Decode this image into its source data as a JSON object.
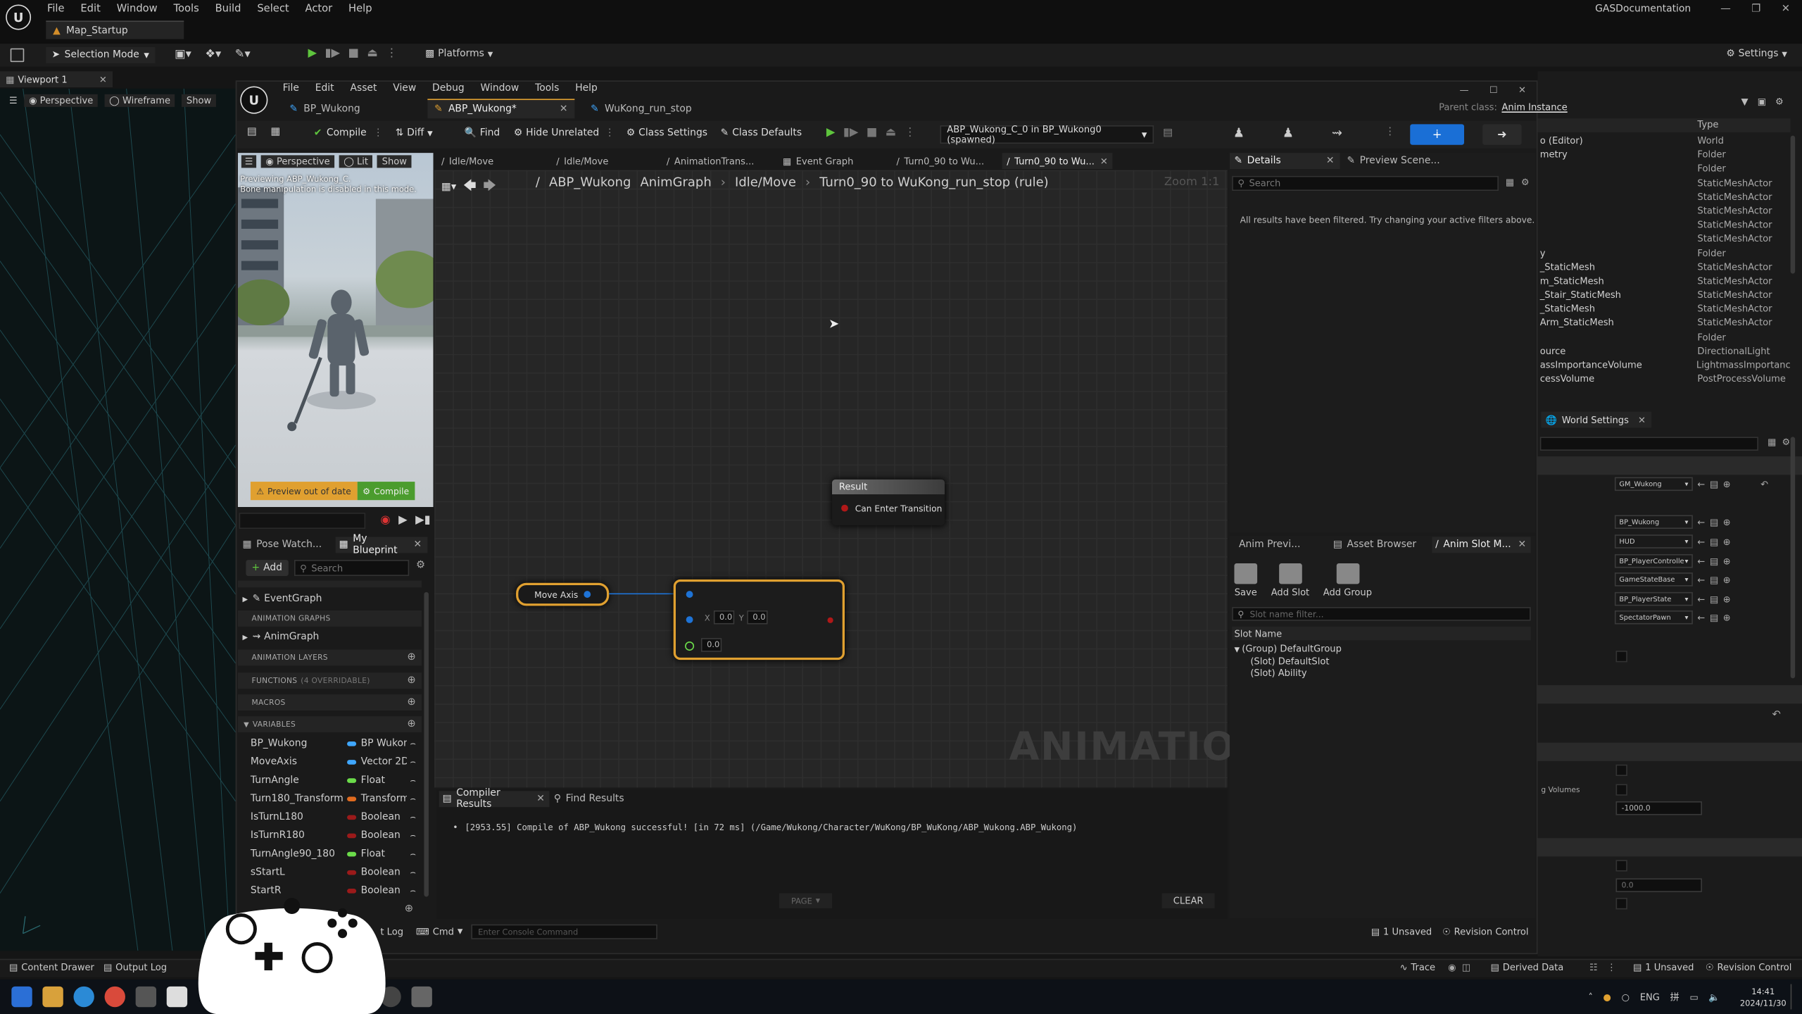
{
  "outer": {
    "menu": [
      "File",
      "Edit",
      "Window",
      "Tools",
      "Build",
      "Select",
      "Actor",
      "Help"
    ],
    "map_tab": "Map_Startup",
    "project": "GASDocumentation",
    "selection_mode": "Selection Mode",
    "platforms": "Platforms",
    "settings": "Settings",
    "viewport_tab": "Viewport 1",
    "perspective": "Perspective",
    "wireframe": "Wireframe",
    "show": "Show",
    "outliner_type_header": "Type",
    "outliner_rows": [
      {
        "name": "o (Editor)",
        "type": "World"
      },
      {
        "name": "metry",
        "type": "Folder"
      },
      {
        "name": "",
        "type": "Folder"
      },
      {
        "name": "",
        "type": "StaticMeshActor"
      },
      {
        "name": "",
        "type": "StaticMeshActor"
      },
      {
        "name": "",
        "type": "StaticMeshActor"
      },
      {
        "name": "",
        "type": "StaticMeshActor"
      },
      {
        "name": "",
        "type": "StaticMeshActor"
      },
      {
        "name": "y",
        "type": "Folder"
      },
      {
        "name": "_StaticMesh",
        "type": "StaticMeshActor"
      },
      {
        "name": "m_StaticMesh",
        "type": "StaticMeshActor"
      },
      {
        "name": "_Stair_StaticMesh",
        "type": "StaticMeshActor"
      },
      {
        "name": "_StaticMesh",
        "type": "StaticMeshActor"
      },
      {
        "name": "Arm_StaticMesh",
        "type": "StaticMeshActor"
      },
      {
        "name": "",
        "type": "Folder"
      },
      {
        "name": "ource",
        "type": "DirectionalLight"
      },
      {
        "name": "assImportanceVolume",
        "type": "LightmassImportanc"
      },
      {
        "name": "cessVolume",
        "type": "PostProcessVolume"
      }
    ],
    "world_settings_tab": "World Settings",
    "ws_dropdowns": [
      "GM_Wukong",
      "BP_Wukong",
      "HUD",
      "BP_PlayerControlle",
      "GameStateBase",
      "BP_PlayerState",
      "SpectatorPawn"
    ],
    "ws_volumes_label": "g Volumes",
    "ws_value_1": "-1000.0",
    "ws_value_2": "0.0",
    "content_drawer": "Content Drawer",
    "output_log": "Output Log",
    "trace": "Trace",
    "derived_data": "Derived Data",
    "unsaved": "1 Unsaved",
    "revision_control": "Revision Control",
    "tray_lang": "ENG",
    "clock_time": "14:41",
    "clock_date": "2024/11/30"
  },
  "inner": {
    "menu": [
      "File",
      "Edit",
      "Asset",
      "View",
      "Debug",
      "Window",
      "Tools",
      "Help"
    ],
    "tabs": [
      "BP_Wukong",
      "ABP_Wukong*",
      "WuKong_run_stop"
    ],
    "parent_class_label": "Parent class:",
    "parent_class_value": "Anim Instance",
    "toolbar": {
      "compile": "Compile",
      "diff": "Diff",
      "find": "Find",
      "hide_unrelated": "Hide Unrelated",
      "class_settings": "Class Settings",
      "class_defaults": "Class Defaults",
      "debug_target": "ABP_Wukong_C_0 in BP_Wukong0 (spawned)"
    },
    "preview": {
      "perspective": "Perspective",
      "lit": "Lit",
      "show": "Show",
      "msg1": "Previewing ABP_Wukong_C.",
      "msg2": "Bone manipulation is disabled in this mode.",
      "out_of_date": "Preview out of date",
      "compile": "Compile"
    },
    "graph_tabs": [
      "Idle/Move",
      "Idle/Move",
      "AnimationTrans...",
      "Event Graph",
      "Turn0_90 to Wu...",
      "Turn0_90 to Wu..."
    ],
    "breadcrumb": [
      "ABP_Wukong",
      "AnimGraph",
      "Idle/Move",
      "Turn0_90 to WuKong_run_stop (rule)"
    ],
    "zoom": "Zoom 1:1",
    "result_node": {
      "title": "Result",
      "pin": "Can Enter Transition"
    },
    "move_axis": "Move Axis",
    "vector_node": {
      "x_label": "X",
      "x_val": "0.0",
      "y_label": "Y",
      "y_val": "0.0",
      "z_val": "0.0"
    },
    "watermark": "ANIMATION",
    "compiler_tab": "Compiler Results",
    "find_results_tab": "Find Results",
    "compile_msg": "[2953.55] Compile of ABP_Wukong successful! [in 72 ms] (/Game/Wukong/Character/WuKong/BP_WuKong/ABP_Wukong.ABP_Wukong)",
    "page": "PAGE",
    "clear": "CLEAR",
    "details_tab": "Details",
    "preview_scene_tab": "Preview Scene...",
    "search_placeholder": "Search",
    "filtered_msg": "All results have been filtered. Try changing your active filters above.",
    "anim_preview_tab": "Anim Previ...",
    "asset_browser_tab": "Asset Browser",
    "anim_slot_tab": "Anim Slot M...",
    "slot_buttons": [
      "Save",
      "Add Slot",
      "Add Group"
    ],
    "slot_filter_placeholder": "Slot name filter...",
    "slot_name_header": "Slot Name",
    "slot_tree": [
      "(Group) DefaultGroup",
      "(Slot) DefaultSlot",
      "(Slot) Ability"
    ],
    "pose_watch_tab": "Pose Watch...",
    "my_blueprint_tab": "My Blueprint",
    "add": "Add",
    "bp_search": "Search",
    "event_graph": "EventGraph",
    "sections": {
      "anim_graphs": "ANIMATION GRAPHS",
      "anim_graph": "AnimGraph",
      "anim_layers": "ANIMATION LAYERS",
      "functions": "FUNCTIONS",
      "overridable": "(4 OVERRIDABLE)",
      "macros": "MACROS",
      "variables": "VARIABLES"
    },
    "variables": [
      {
        "name": "BP_Wukong",
        "type": "BP Wukon",
        "color": "#3fa7ff"
      },
      {
        "name": "MoveAxis",
        "type": "Vector 2D",
        "color": "#3fa7ff"
      },
      {
        "name": "TurnAngle",
        "type": "Float",
        "color": "#6bdc4a"
      },
      {
        "name": "Turn180_Transform",
        "type": "Transform",
        "color": "#e06b1f"
      },
      {
        "name": "IsTurnL180",
        "type": "Boolean",
        "color": "#9b1a1a"
      },
      {
        "name": "IsTurnR180",
        "type": "Boolean",
        "color": "#9b1a1a"
      },
      {
        "name": "TurnAngle90_180",
        "type": "Float",
        "color": "#6bdc4a"
      },
      {
        "name": "sStartL",
        "type": "Boolean",
        "color": "#9b1a1a"
      },
      {
        "name": "StartR",
        "type": "Boolean",
        "color": "#9b1a1a"
      }
    ],
    "bottom": {
      "log": "t Log",
      "cmd": "Cmd",
      "console_placeholder": "Enter Console Command",
      "unsaved": "1 Unsaved",
      "revision_control": "Revision Control"
    }
  }
}
